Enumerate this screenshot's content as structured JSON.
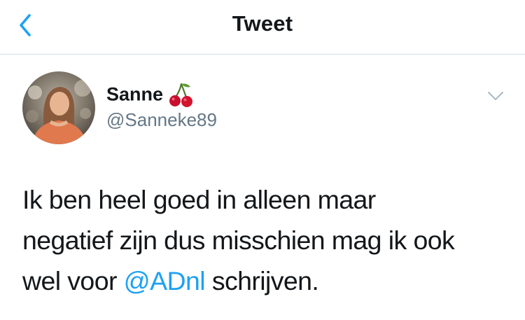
{
  "header": {
    "title": "Tweet",
    "back_icon": "chevron-left-icon"
  },
  "author": {
    "name": "Sanne",
    "emoji": "cherries",
    "handle": "@Sanneke89"
  },
  "tweet": {
    "line1": "Ik ben heel goed in alleen maar",
    "line2": "negatief zijn dus misschien mag ik ook",
    "line3_before": "wel voor ",
    "mention": "@ADnl",
    "line3_after": " schrijven."
  },
  "colors": {
    "accent": "#1da1f2",
    "text": "#14171a",
    "secondary": "#657786",
    "divider": "#d8dde2"
  }
}
